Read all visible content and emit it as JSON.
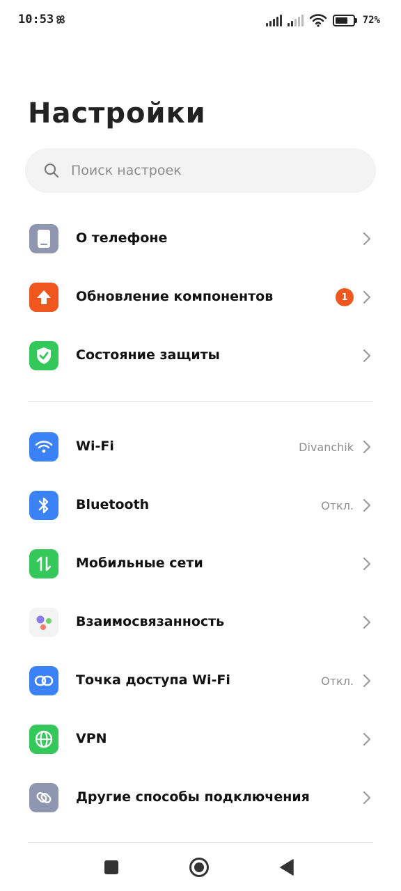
{
  "status_bar": {
    "time": "10:53",
    "battery_percent": "72%",
    "battery_level": 0.72,
    "icons": [
      "fan-icon",
      "signal-icon",
      "signal-icon",
      "wifi-icon",
      "battery-icon"
    ]
  },
  "page": {
    "title": "Настройки"
  },
  "search": {
    "placeholder": "Поиск настроек"
  },
  "group1": [
    {
      "label": "О телефоне",
      "icon": "phone-icon",
      "color": "#8e96b0"
    },
    {
      "label": "Обновление компонентов",
      "icon": "arrow-up-icon",
      "color": "#f0571e",
      "badge": "1"
    },
    {
      "label": "Состояние защиты",
      "icon": "shield-icon",
      "color": "#34c759"
    }
  ],
  "group2": [
    {
      "label": "Wi-Fi",
      "icon": "wifi-icon",
      "color": "#3b82f6",
      "value": "Divanchik"
    },
    {
      "label": "Bluetooth",
      "icon": "bluetooth-icon",
      "color": "#3b82f6",
      "value": "Откл."
    },
    {
      "label": "Мобильные сети",
      "icon": "mobile-data-icon",
      "color": "#34c759"
    },
    {
      "label": "Взаимосвязанность",
      "icon": "interconnect-icon",
      "color": "#f3f3f3"
    },
    {
      "label": "Точка доступа Wi-Fi",
      "icon": "hotspot-icon",
      "color": "#3b82f6",
      "value": "Откл."
    },
    {
      "label": "VPN",
      "icon": "globe-icon",
      "color": "#34c759"
    },
    {
      "label": "Другие способы подключения",
      "icon": "link-icon",
      "color": "#8e96b0"
    }
  ],
  "nav": {
    "icons": [
      "recents-icon",
      "home-icon",
      "back-icon"
    ]
  }
}
